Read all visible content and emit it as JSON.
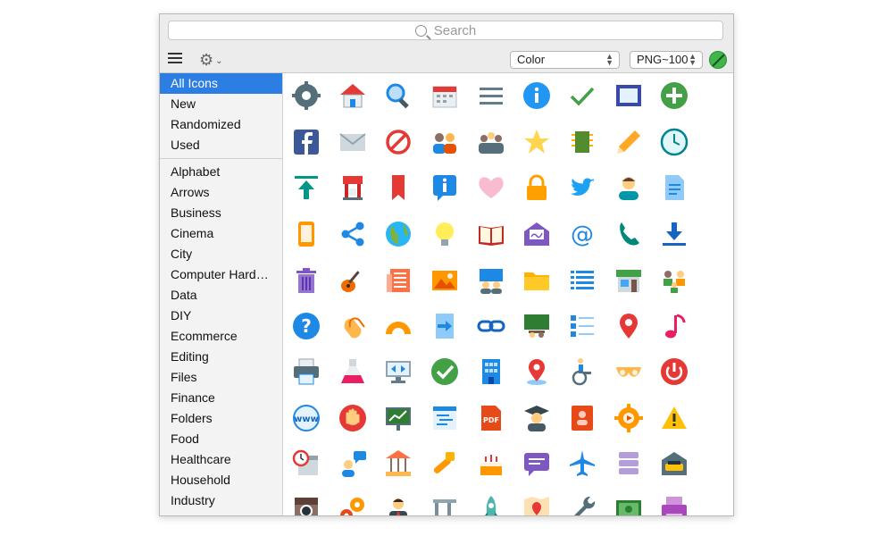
{
  "search": {
    "placeholder": "Search"
  },
  "toolbar": {
    "color_select": "Color",
    "format_select": "PNG~100"
  },
  "sidebar": {
    "groups": [
      [
        "All Icons",
        "New",
        "Randomized",
        "Used"
      ],
      [
        "Alphabet",
        "Arrows",
        "Business",
        "Cinema",
        "City",
        "Computer Hard…",
        "Data",
        "DIY",
        "Ecommerce",
        "Editing",
        "Files",
        "Finance",
        "Folders",
        "Food",
        "Healthcare",
        "Household",
        "Industry"
      ]
    ],
    "selected": "All Icons"
  },
  "icons": [
    [
      "settings-icon",
      "home-icon",
      "search-icon",
      "calendar-icon",
      "menu-icon",
      "info-icon",
      "checkmark-icon",
      "picture-frame-icon",
      "plus-icon"
    ],
    [
      "facebook-icon",
      "mail-icon",
      "no-entry-icon",
      "user-group-icon",
      "meeting-icon",
      "star-icon",
      "chip-icon",
      "pencil-icon",
      "clock-icon"
    ],
    [
      "upload-icon",
      "coffee-machine-icon",
      "bookmark-icon",
      "info-popup-icon",
      "like-icon",
      "lock-icon",
      "twitter-icon",
      "user-icon",
      "document-icon"
    ],
    [
      "tablet-icon",
      "share-icon",
      "globe-icon",
      "idea-icon",
      "book-icon",
      "invite-icon",
      "at-sign-icon",
      "phone-icon",
      "download-icon"
    ],
    [
      "trash-icon",
      "guitar-icon",
      "news-icon",
      "image-icon",
      "conference-icon",
      "folder-icon",
      "list-icon",
      "shop-icon",
      "family-icon"
    ],
    [
      "help-icon",
      "clapping-hands-icon",
      "protractor-icon",
      "import-icon",
      "link-icon",
      "classroom-icon",
      "checklist-icon",
      "marker-icon",
      "music-icon"
    ],
    [
      "print-icon",
      "flask-icon",
      "monitor-icon",
      "ok-icon",
      "office-icon",
      "map-pin-icon",
      "wheelchair-icon",
      "bra-icon",
      "power-icon"
    ],
    [
      "www-icon",
      "stop-hand-icon",
      "chart-board-icon",
      "text-panel-icon",
      "pdf-icon",
      "graduate-icon",
      "address-book-icon",
      "video-gear-icon",
      "warning-icon"
    ],
    [
      "schedule-icon",
      "chat-user-icon",
      "carousel-icon",
      "chainsaw-icon",
      "cake-icon",
      "comment-icon",
      "airplane-icon",
      "database-icon",
      "taxi-icon"
    ],
    [
      "instagram-icon",
      "gears-icon",
      "businessman-icon",
      "caliper-icon",
      "rocket-icon",
      "map-icon",
      "wrench-icon",
      "money-icon",
      "printer-paper-icon"
    ]
  ]
}
